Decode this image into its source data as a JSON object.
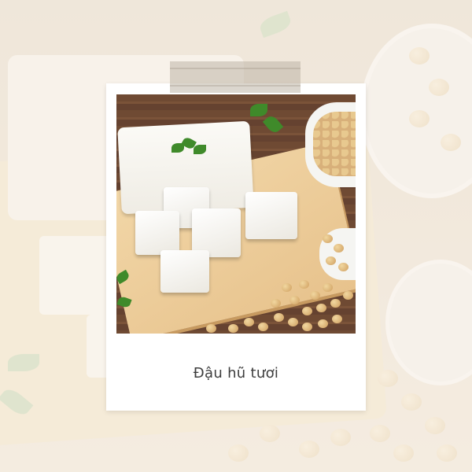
{
  "card": {
    "caption": "Đậu hũ tươi"
  },
  "colors": {
    "card_background": "#ffffff",
    "caption_text": "#3d3d3d",
    "wood_table": "#6f4a33",
    "cutting_board": "#f2d7a8",
    "tofu": "#fbfaf6",
    "soybean": "#e0b57a",
    "herb_leaf": "#3f8a2a"
  },
  "icons": {
    "tape": "tape-strip",
    "photo": "tofu-and-soybeans-photo"
  }
}
